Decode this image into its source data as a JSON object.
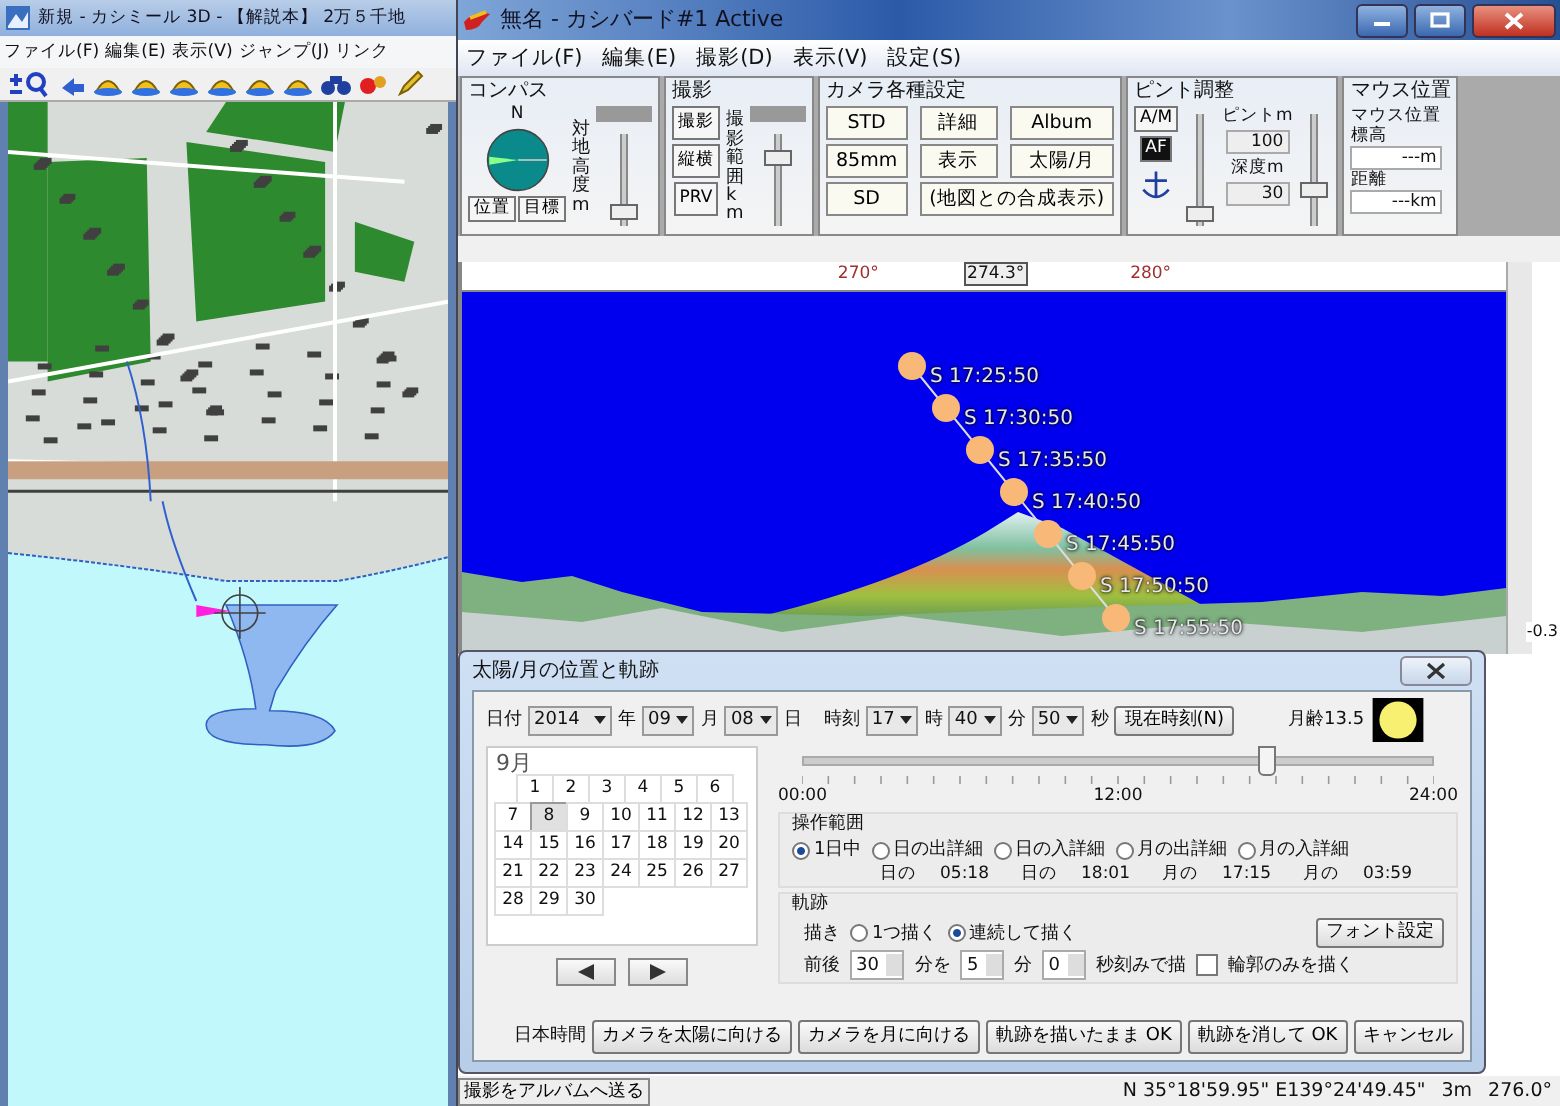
{
  "map_window": {
    "title": "新規 - カシミール 3D - 【解説本】 2万５千地",
    "menu": [
      "ファイル(F)",
      "編集(E)",
      "表示(V)",
      "ジャンプ(J)",
      "リンク"
    ]
  },
  "main_window": {
    "title": "無名 - カシバード#1 Active",
    "menu": [
      "ファイル(F)",
      "編集(E)",
      "撮影(D)",
      "表示(V)",
      "設定(S)"
    ],
    "compass": {
      "title": "コンパス",
      "north": "N",
      "buttons": [
        "位置",
        "目標"
      ],
      "slider_label": "対地高度m",
      "level": 0.08
    },
    "shoot": {
      "title": "撮影",
      "buttons": [
        "撮影",
        "縦横",
        "PRV"
      ],
      "slider_label": "撮影範囲km",
      "level": 0.8
    },
    "camera": {
      "title": "カメラ各種設定",
      "buttons": [
        "STD",
        "詳細",
        "Album",
        "85mm",
        "表示",
        "太陽/月",
        "SD",
        "(地図との合成表示)"
      ]
    },
    "focus": {
      "title": "ピント調整",
      "mode": "A/M",
      "af": "AF",
      "focus_label": "ピントm",
      "focus_value": "100",
      "focus_slider": {
        "level": 0.05
      },
      "depth_label": "深度m",
      "depth_value": "30",
      "depth_slider": {
        "level": 0.3
      }
    },
    "mouse": {
      "title": "マウス位置",
      "subtitle": "マウス位置",
      "elevation_label": "標高",
      "elevation_value": "---m",
      "distance_label": "距離",
      "distance_value": "---km"
    },
    "ruler": [
      {
        "text": "270°",
        "kind": "tick"
      },
      {
        "text": "274.3°",
        "kind": "marker"
      },
      {
        "text": "280°",
        "kind": "tick"
      }
    ],
    "sun_labels": [
      "S 17:25:50",
      "S 17:30:50",
      "S 17:35:50",
      "S 17:40:50",
      "S 17:45:50",
      "S 17:50:50",
      "S 17:55:50"
    ],
    "side_label": "-0.3",
    "status_bar": {
      "button": "撮影をアルバムへ送る",
      "coordinates": "N 35°18'59.95\" E139°24'49.45\"",
      "distance": "3m",
      "bearing": "276.0°"
    }
  },
  "dialog": {
    "title": "太陽/月の位置と軌跡",
    "date_label": "日付",
    "year": "2014",
    "year_unit": "年",
    "month": "09",
    "month_unit": "月",
    "day": "08",
    "day_unit": "日",
    "time_label": "時刻",
    "hour": "17",
    "hour_unit": "時",
    "minute": "40",
    "minute_unit": "分",
    "second": "50",
    "second_unit": "秒",
    "now_button": "現在時刻(N)",
    "moon_age": "月齢13.5",
    "calendar": {
      "month": "9月",
      "weeks": [
        [
          {
            "day": "1",
            "selected": false
          },
          {
            "day": "2",
            "selected": false
          },
          {
            "day": "3",
            "selected": false
          },
          {
            "day": "4",
            "selected": false
          },
          {
            "day": "5",
            "selected": false
          },
          {
            "day": "6",
            "selected": false
          }
        ],
        [
          {
            "day": "7",
            "selected": false
          },
          {
            "day": "8",
            "selected": true
          },
          {
            "day": "9",
            "selected": false
          },
          {
            "day": "10",
            "selected": false
          },
          {
            "day": "11",
            "selected": false
          },
          {
            "day": "12",
            "selected": false
          },
          {
            "day": "13",
            "selected": false
          }
        ],
        [
          {
            "day": "14",
            "selected": false
          },
          {
            "day": "15",
            "selected": false
          },
          {
            "day": "16",
            "selected": false
          },
          {
            "day": "17",
            "selected": false
          },
          {
            "day": "18",
            "selected": false
          },
          {
            "day": "19",
            "selected": false
          },
          {
            "day": "20",
            "selected": false
          }
        ],
        [
          {
            "day": "21",
            "selected": false
          },
          {
            "day": "22",
            "selected": false
          },
          {
            "day": "23",
            "selected": false
          },
          {
            "day": "24",
            "selected": false
          },
          {
            "day": "25",
            "selected": false
          },
          {
            "day": "26",
            "selected": false
          },
          {
            "day": "27",
            "selected": false
          }
        ],
        [
          {
            "day": "28",
            "selected": false
          },
          {
            "day": "29",
            "selected": false
          },
          {
            "day": "30",
            "selected": false
          }
        ]
      ]
    },
    "time_slider": {
      "level": 0.736,
      "labels": [
        "00:00",
        "12:00",
        "24:00"
      ]
    },
    "range_group": {
      "title": "操作範囲",
      "options": [
        {
          "label": "1日中",
          "selected": true
        },
        {
          "label": "日の出詳細",
          "selected": false
        },
        {
          "label": "日の入詳細",
          "selected": false
        },
        {
          "label": "月の出詳細",
          "selected": false
        },
        {
          "label": "月の入詳細",
          "selected": false
        }
      ],
      "times": [
        {
          "label": "日の",
          "value": "05:18"
        },
        {
          "label": "日の",
          "value": "18:01"
        },
        {
          "label": "月の",
          "value": "17:15"
        },
        {
          "label": "月の",
          "value": "03:59"
        }
      ]
    },
    "track_group": {
      "title": "軌跡",
      "draw_label": "描き",
      "options": [
        {
          "label": "1つ描く",
          "selected": false
        },
        {
          "label": "連続して描く",
          "selected": true
        }
      ],
      "font_button": "フォント設定",
      "before_after": "前後",
      "span": "30",
      "span_unit": "分を",
      "step_min": "5",
      "step_min_unit": "分",
      "step_sec": "0",
      "step_sec_unit": "秒刻みで描",
      "outline": {
        "label": "輪郭のみを描く",
        "checked": false
      }
    },
    "timezone": "日本時間",
    "buttons": [
      "カメラを太陽に向ける",
      "カメラを月に向ける",
      "軌跡を描いたまま OK",
      "軌跡を消して OK",
      "キャンセル"
    ]
  }
}
